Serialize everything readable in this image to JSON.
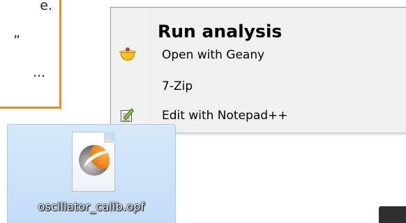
{
  "callout": {
    "line1": "e.",
    "line2": "”",
    "line3": "..."
  },
  "context_menu": {
    "items": [
      {
        "label": "Run analysis",
        "bold": true,
        "icon": ""
      },
      {
        "label": "Open with Geany",
        "bold": false,
        "icon": "geany-icon"
      },
      {
        "label": "7-Zip",
        "bold": false,
        "icon": ""
      },
      {
        "label": "Edit with Notepad++",
        "bold": false,
        "icon": "notepadpp-icon"
      }
    ]
  },
  "desktop_file": {
    "name": "oscillator_calib.opf",
    "icon": "opf-file-icon",
    "selected": true
  },
  "colors": {
    "callout_border": "#f28a1c",
    "menu_background": "#f0f0f0",
    "selection_background": "#c3ddf7"
  }
}
